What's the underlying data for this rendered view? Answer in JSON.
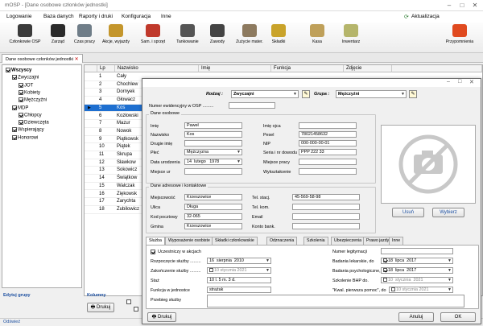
{
  "app": {
    "title": "mOSP - [Dane osobowe członków jednostki]",
    "update": "Aktualizacja"
  },
  "menu": [
    "Logowanie",
    "Baza danych",
    "Raporty i druki",
    "Konfiguracja",
    "Inne"
  ],
  "toolbar": [
    {
      "label": "Członkowie OSP",
      "color": "#3a3a3a"
    },
    {
      "label": "Zarząd",
      "color": "#2b2b2b"
    },
    {
      "label": "Czas pracy",
      "color": "#6f7d88"
    },
    {
      "label": "Akcje, wyjazdy",
      "color": "#c4962c"
    },
    {
      "label": "Sam. i sprzęt",
      "color": "#c0392b"
    },
    {
      "label": "Tankowanie",
      "color": "#555"
    },
    {
      "label": "Zawody",
      "color": "#444"
    },
    {
      "label": "Zużycie mater.",
      "color": "#8d7a5f"
    },
    {
      "label": "Składki",
      "color": "#c9a32a"
    },
    {
      "label": "Kasa",
      "color": "#bfa05a"
    },
    {
      "label": "Inwentarz",
      "color": "#b5b56b"
    },
    {
      "label": "Przypomnienia",
      "color": "#e04a1f"
    }
  ],
  "doc_tab": "Dane osobowe członków jednostki",
  "tree": [
    {
      "label": "Wszyscy",
      "bold": true,
      "checked": true,
      "indent": 0
    },
    {
      "label": "Zwyczajni",
      "checked": true,
      "indent": 1
    },
    {
      "label": "JOT",
      "checked": true,
      "indent": 2
    },
    {
      "label": "Kobiety",
      "checked": true,
      "indent": 2
    },
    {
      "label": "Mężczyźni",
      "checked": true,
      "indent": 2
    },
    {
      "label": "MDP",
      "checked": true,
      "indent": 1
    },
    {
      "label": "Chłopcy",
      "checked": true,
      "indent": 2
    },
    {
      "label": "Dziewczęta",
      "checked": true,
      "indent": 2
    },
    {
      "label": "Wspierający",
      "checked": true,
      "indent": 1
    },
    {
      "label": "Honorowi",
      "checked": true,
      "indent": 1
    }
  ],
  "edit_groups": "Edytuj grupy",
  "columns_label": "Kolumny",
  "print": "Drukuj",
  "status": "Odświeź",
  "grid": {
    "headers": [
      "Lp",
      "Nazwisko",
      "Imię",
      "Funkcja",
      "Zdjęcie"
    ],
    "rows": [
      {
        "n": "1",
        "s": "Cały"
      },
      {
        "n": "2",
        "s": "Chochlew"
      },
      {
        "n": "3",
        "s": "Dornyek"
      },
      {
        "n": "4",
        "s": "Głowacz"
      },
      {
        "n": "5",
        "s": "Kos",
        "sel": true
      },
      {
        "n": "6",
        "s": "Kozłowski"
      },
      {
        "n": "7",
        "s": "Mazur"
      },
      {
        "n": "8",
        "s": "Nowok"
      },
      {
        "n": "9",
        "s": "Piątkowsk"
      },
      {
        "n": "10",
        "s": "Piątek"
      },
      {
        "n": "11",
        "s": "Skrupa"
      },
      {
        "n": "12",
        "s": "Sławkow"
      },
      {
        "n": "13",
        "s": "Sokowicz"
      },
      {
        "n": "14",
        "s": "Świątkow"
      },
      {
        "n": "15",
        "s": "Walczak"
      },
      {
        "n": "16",
        "s": "Ziękowsk"
      },
      {
        "n": "17",
        "s": "Zarychta"
      },
      {
        "n": "18",
        "s": "Zubilowicz"
      }
    ]
  },
  "dialog": {
    "rodzaj_label": "Rodzaj :",
    "rodzaj": "Zwyczajni",
    "grupa_label": "Grupa :",
    "grupa": "Mężczyźni",
    "nr_ewid_label": "Numer ewidencyjny w OSP .........",
    "dane_osobowe": "Dane osobowe",
    "imie_label": "Imię",
    "imie": "Paweł",
    "nazwisko_label": "Nazwisko",
    "nazwisko": "Kos",
    "drugie_imie_label": "Drugie imię",
    "plec_label": "Płeć",
    "plec": "Mężczyzna",
    "data_ur_label": "Data urodzenia",
    "dzien": "14",
    "miesiac": "lutego",
    "rok": "1978",
    "miejsce_ur_label": "Miejsce ur",
    "imie_ojca_label": "Imię ojca",
    "pesel_label": "Pesel",
    "pesel": "78021458632",
    "nip_label": "NIP",
    "nip": "000-000-00-01",
    "seria_label": "Seria i nr dowodu",
    "seria": "PPP 222 33",
    "miejsce_pracy_label": "Miejsce pracy",
    "wyksztalcenie_label": "Wykształcenie",
    "dane_adresowe": "Dane adresowe i kontaktowe",
    "miejscowosc_label": "Miejscowość",
    "miejscowosc": "Krzeszowice",
    "ulica_label": "Ulica",
    "ulica": "Długa",
    "kod_label": "Kod pocztowy",
    "kod": "32-065",
    "gmina_label": "Gmina",
    "gmina": "Krzeszowice",
    "tel_stac_label": "Tel. stacj.",
    "tel_stac": "45-569-58-98",
    "tel_kom_label": "Tel. kom.",
    "email_label": "Email",
    "konto_label": "Konto bank.",
    "usun": "Usuń",
    "wybierz": "Wybierz",
    "tabs": [
      "Służba",
      "Wyposażenie osobiste",
      "Składki członkowskie",
      "Odznaczenia",
      "Szkolenia",
      "Ubezpieczenia",
      "Prawo jazdy",
      "Inne"
    ],
    "uczestniczy_label": "Uczestniczy w akcjach",
    "rozpoczecie_label": "Rozpoczęcie służby .........",
    "rozp_d": "16",
    "rozp_m": "sierpnia",
    "rozp_r": "2010",
    "zakonczenie_label": "Zakończenie służby .........",
    "zak_d": "10",
    "zak_m": "stycznia",
    "zak_r": "2021",
    "staz_label": "Staż",
    "staz": "10 l. 5 m. 3 d.",
    "funkcja_label": "Funkcja w jednostce",
    "funkcja": "strażak",
    "przebieg_label": "Przebieg służby",
    "nr_legit_label": "Numer legitymacji",
    "badania_lek_label": "Badania lekarskie, do",
    "bl_d": "18",
    "bl_m": "lipca",
    "bl_r": "2017",
    "badania_psych_label": "Badania psychologiczne, do",
    "bp_d": "18",
    "bp_m": "lipca",
    "bp_r": "2017",
    "bhp_label": "Szkolenie BHP do.",
    "bhp_d": "10",
    "bhp_m": "stycznia",
    "bhp_r": "2021",
    "kwal_label": "\"Kwal. pierwsza pomoc\", do",
    "kw_d": "10",
    "kw_m": "stycznia",
    "kw_r": "2021",
    "drukuj": "Drukuj",
    "anuluj": "Anuluj",
    "ok": "OK"
  }
}
